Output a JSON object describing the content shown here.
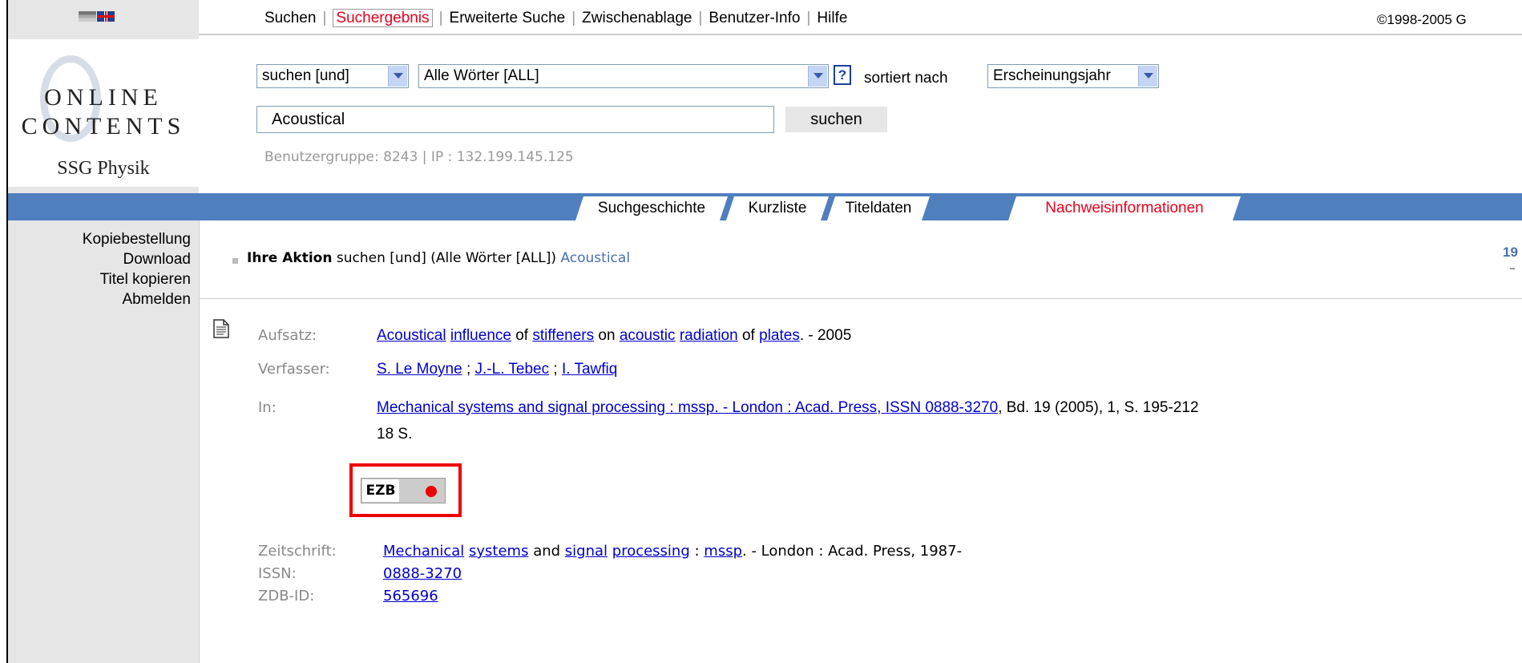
{
  "topnav": {
    "items": [
      "Suchen",
      "Suchergebnis",
      "Erweiterte Suche",
      "Zwischenablage",
      "Benutzer-Info",
      "Hilfe"
    ],
    "active_index": 1,
    "copyright": "©1998-2005 G"
  },
  "logo": {
    "line1": "ONLINE",
    "line2": "CONTENTS",
    "line3": "SSG Physik"
  },
  "sidebar": {
    "items": [
      "Kopiebestellung",
      "Download",
      "Titel kopieren",
      "Abmelden"
    ]
  },
  "search": {
    "operator_select": "suchen [und]",
    "field_select": "Alle Wörter [ALL]",
    "help_label": "?",
    "sort_label": "sortiert nach",
    "sort_select": "Erscheinungsjahr",
    "query": "Acoustical",
    "submit_label": "suchen",
    "user_info": "Benutzergruppe: 8243 | IP : 132.199.145.125"
  },
  "tabs": [
    {
      "label": "Suchgeschichte"
    },
    {
      "label": "Kurzliste"
    },
    {
      "label": "Titeldaten"
    },
    {
      "label": "Nachweisinformationen",
      "active": true
    }
  ],
  "action": {
    "label": "Ihre Aktion",
    "text": "suchen [und] (Alle Wörter [ALL])",
    "query": "Acoustical",
    "corner": "19"
  },
  "record": {
    "aufsatz_label": "Aufsatz:",
    "title_words": [
      "Acoustical",
      "influence",
      "of",
      "stiffeners",
      "on",
      "acoustic",
      "radiation",
      "of",
      "plates"
    ],
    "title_suffix": ". - 2005",
    "verfasser_label": "Verfasser:",
    "authors": [
      "S. Le Moyne",
      "J.-L. Tebec",
      "I. Tawfiq"
    ],
    "author_sep": " ; ",
    "in_label": "In:",
    "in_link": "Mechanical systems and signal processing : mssp. - London : Acad. Press, ISSN 0888-3270",
    "in_rest": ", Bd. 19 (2005), 1, S. 195-212",
    "in_line2": "18 S.",
    "ezb_label": "EZB",
    "zeitschrift_label": "Zeitschrift:",
    "zs_w1": "Mechanical",
    "zs_w2": "systems",
    "zs_and": " and ",
    "zs_w3": "signal",
    "zs_w4": "processing",
    "zs_colon": " : ",
    "zs_w5": "mssp",
    "zs_rest": ". - London : Acad. Press, 1987-",
    "issn_label": "ISSN:",
    "issn": "0888-3270",
    "zdb_label": "ZDB-ID:",
    "zdb": "565696"
  },
  "colors": {
    "accent_red": "#e8001c",
    "bar_blue": "#4f7fbf",
    "link_blue": "#0000cc"
  }
}
